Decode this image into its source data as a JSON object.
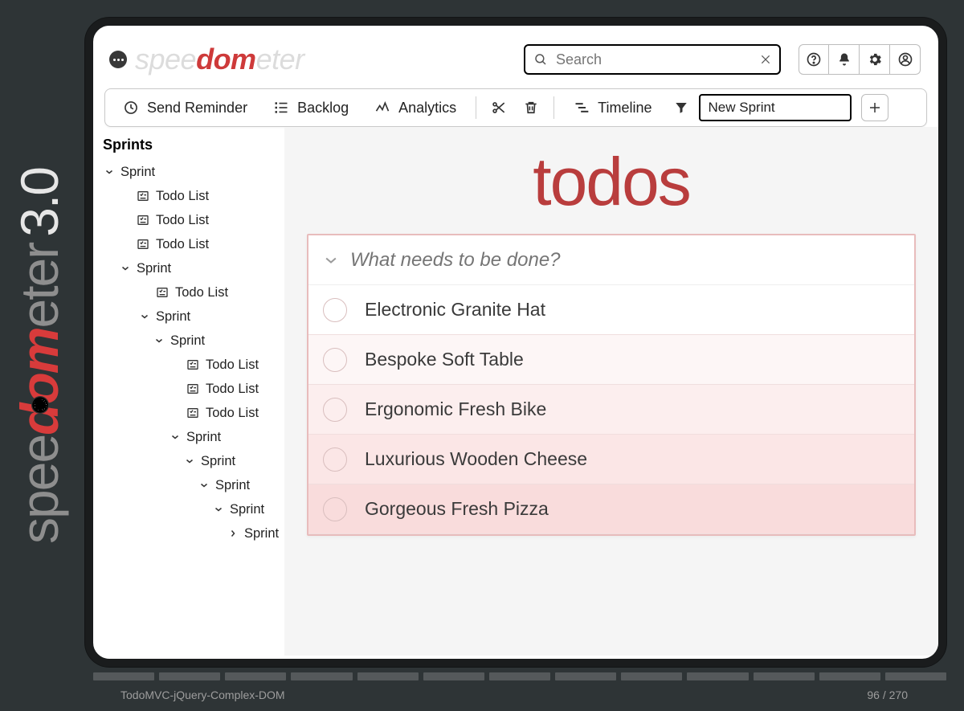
{
  "brand": {
    "pre": "spee",
    "em": "dom",
    "post": "eter",
    "version": "3.0"
  },
  "footer": {
    "caption": "TodoMVC-jQuery-Complex-DOM",
    "progress": "96 / 270"
  },
  "topbar": {
    "search_placeholder": "Search"
  },
  "toolbar": {
    "send_reminder": "Send Reminder",
    "backlog": "Backlog",
    "analytics": "Analytics",
    "timeline": "Timeline",
    "new_sprint": "New Sprint"
  },
  "sidebar": {
    "title": "Sprints",
    "tree": [
      {
        "lvl": 0,
        "kind": "sprint",
        "label": "Sprint"
      },
      {
        "lvl": 1,
        "kind": "list",
        "label": "Todo List"
      },
      {
        "lvl": 1,
        "kind": "list",
        "label": "Todo List"
      },
      {
        "lvl": 1,
        "kind": "list",
        "label": "Todo List"
      },
      {
        "lvl": 1,
        "kind": "sprint",
        "label": "Sprint"
      },
      {
        "lvl": 2,
        "kind": "list",
        "label": "Todo List"
      },
      {
        "lvl": 2,
        "kind": "sprint",
        "label": "Sprint"
      },
      {
        "lvl": 3,
        "kind": "sprint",
        "label": "Sprint"
      },
      {
        "lvl": 4,
        "kind": "list",
        "label": "Todo List"
      },
      {
        "lvl": 4,
        "kind": "list",
        "label": "Todo List"
      },
      {
        "lvl": 4,
        "kind": "list",
        "label": "Todo List"
      },
      {
        "lvl": 4,
        "kind": "sprint",
        "label": "Sprint"
      },
      {
        "lvl": 5,
        "kind": "sprint",
        "label": "Sprint"
      },
      {
        "lvl": 6,
        "kind": "sprint",
        "label": "Sprint"
      },
      {
        "lvl": 7,
        "kind": "sprint",
        "label": "Sprint"
      },
      {
        "lvl": 8,
        "kind": "sprint-collapsed",
        "label": "Sprint"
      }
    ]
  },
  "content": {
    "title": "todos",
    "new_todo_placeholder": "What needs to be done?",
    "items": [
      "Electronic Granite Hat",
      "Bespoke Soft Table",
      "Ergonomic Fresh Bike",
      "Luxurious Wooden Cheese",
      "Gorgeous Fresh Pizza"
    ]
  }
}
